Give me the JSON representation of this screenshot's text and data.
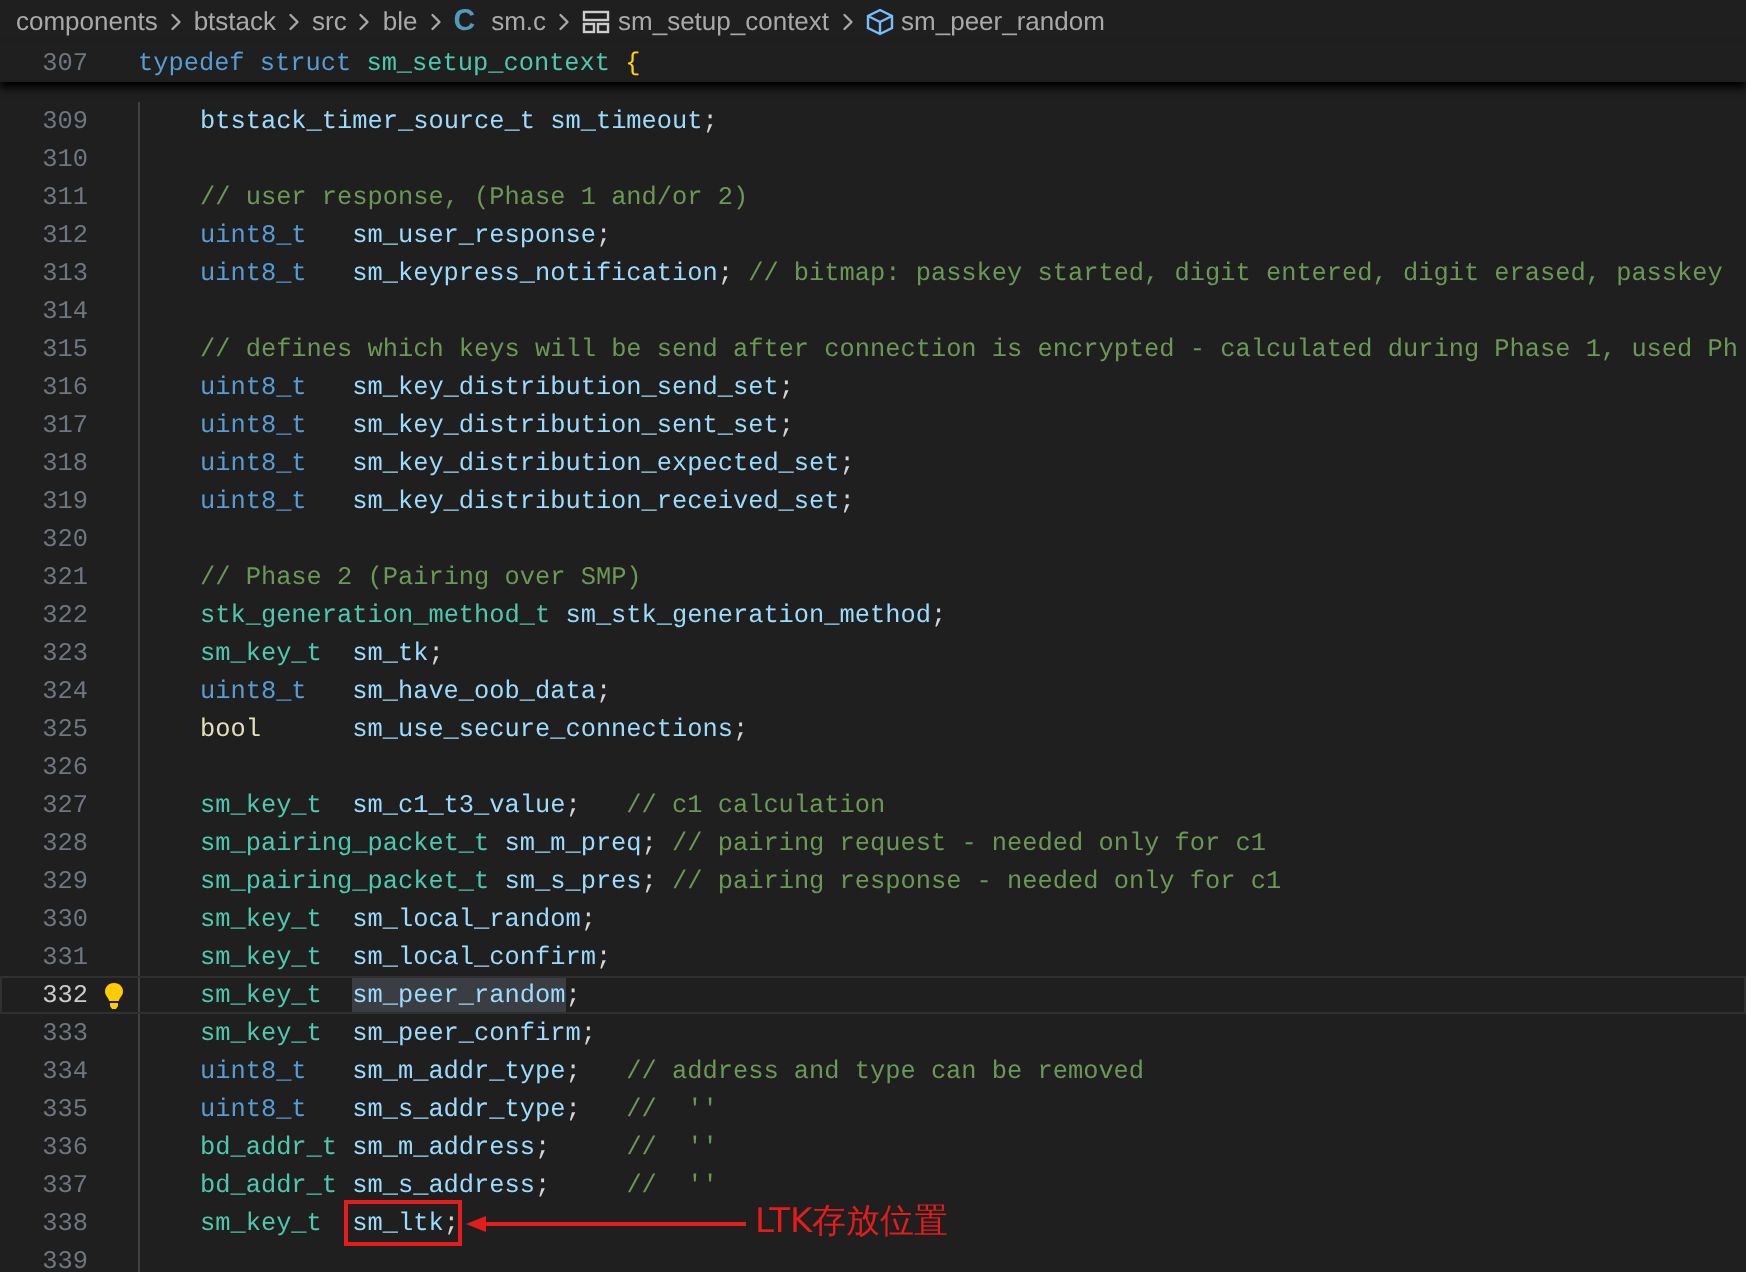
{
  "breadcrumbs": [
    {
      "kind": "folder",
      "label": "components"
    },
    {
      "kind": "folder",
      "label": "btstack"
    },
    {
      "kind": "folder",
      "label": "src"
    },
    {
      "kind": "folder",
      "label": "ble"
    },
    {
      "kind": "file",
      "icon_text": "C",
      "label": "sm.c"
    },
    {
      "kind": "struct",
      "label": "sm_setup_context"
    },
    {
      "kind": "field",
      "label": "sm_peer_random"
    }
  ],
  "sticky_line": {
    "number": "307",
    "keywords": [
      "typedef",
      "struct"
    ],
    "name": "sm_setup_context",
    "brace": "{"
  },
  "lines": [
    {
      "number": "309",
      "current": false,
      "lightbulb": false,
      "type": {
        "text": "btstack_timer_source_t",
        "kind": "plain"
      },
      "name": "sm_timeout",
      "punct": ";"
    },
    {
      "number": "310",
      "current": false,
      "lightbulb": false
    },
    {
      "number": "311",
      "current": false,
      "lightbulb": false,
      "comment": "// user response, (Phase 1 and/or 2)"
    },
    {
      "number": "312",
      "current": false,
      "lightbulb": false,
      "type": {
        "text": "uint8_t",
        "kind": "builtin"
      },
      "name": "sm_user_response",
      "punct": ";"
    },
    {
      "number": "313",
      "current": false,
      "lightbulb": false,
      "type": {
        "text": "uint8_t",
        "kind": "builtin"
      },
      "name": "sm_keypress_notification",
      "punct": ";",
      "comment": "// bitmap: passkey started, digit entered, digit erased, passkey"
    },
    {
      "number": "314",
      "current": false,
      "lightbulb": false
    },
    {
      "number": "315",
      "current": false,
      "lightbulb": false,
      "comment": "// defines which keys will be send after connection is encrypted - calculated during Phase 1, used Ph"
    },
    {
      "number": "316",
      "current": false,
      "lightbulb": false,
      "type": {
        "text": "uint8_t",
        "kind": "builtin"
      },
      "name": "sm_key_distribution_send_set",
      "punct": ";"
    },
    {
      "number": "317",
      "current": false,
      "lightbulb": false,
      "type": {
        "text": "uint8_t",
        "kind": "builtin"
      },
      "name": "sm_key_distribution_sent_set",
      "punct": ";"
    },
    {
      "number": "318",
      "current": false,
      "lightbulb": false,
      "type": {
        "text": "uint8_t",
        "kind": "builtin"
      },
      "name": "sm_key_distribution_expected_set",
      "punct": ";"
    },
    {
      "number": "319",
      "current": false,
      "lightbulb": false,
      "type": {
        "text": "uint8_t",
        "kind": "builtin"
      },
      "name": "sm_key_distribution_received_set",
      "punct": ";"
    },
    {
      "number": "320",
      "current": false,
      "lightbulb": false
    },
    {
      "number": "321",
      "current": false,
      "lightbulb": false,
      "comment": "// Phase 2 (Pairing over SMP)"
    },
    {
      "number": "322",
      "current": false,
      "lightbulb": false,
      "type": {
        "text": "stk_generation_method_t",
        "kind": "user"
      },
      "name": "sm_stk_generation_method",
      "punct": ";"
    },
    {
      "number": "323",
      "current": false,
      "lightbulb": false,
      "type": {
        "text": "sm_key_t",
        "kind": "user"
      },
      "name": "sm_tk",
      "punct": ";"
    },
    {
      "number": "324",
      "current": false,
      "lightbulb": false,
      "type": {
        "text": "uint8_t",
        "kind": "builtin"
      },
      "name": "sm_have_oob_data",
      "punct": ";"
    },
    {
      "number": "325",
      "current": false,
      "lightbulb": false,
      "type": {
        "text": "bool",
        "kind": "bool"
      },
      "name": "sm_use_secure_connections",
      "punct": ";"
    },
    {
      "number": "326",
      "current": false,
      "lightbulb": false
    },
    {
      "number": "327",
      "current": false,
      "lightbulb": false,
      "type": {
        "text": "sm_key_t",
        "kind": "user"
      },
      "name": "sm_c1_t3_value",
      "punct": ";",
      "comment": "// c1 calculation"
    },
    {
      "number": "328",
      "current": false,
      "lightbulb": false,
      "type": {
        "text": "sm_pairing_packet_t",
        "kind": "user"
      },
      "name": "sm_m_preq",
      "punct": ";",
      "comment": "// pairing request - needed only for c1"
    },
    {
      "number": "329",
      "current": false,
      "lightbulb": false,
      "type": {
        "text": "sm_pairing_packet_t",
        "kind": "user"
      },
      "name": "sm_s_pres",
      "punct": ";",
      "comment": "// pairing response - needed only for c1"
    },
    {
      "number": "330",
      "current": false,
      "lightbulb": false,
      "type": {
        "text": "sm_key_t",
        "kind": "user"
      },
      "name": "sm_local_random",
      "punct": ";"
    },
    {
      "number": "331",
      "current": false,
      "lightbulb": false,
      "type": {
        "text": "sm_key_t",
        "kind": "user"
      },
      "name": "sm_local_confirm",
      "punct": ";"
    },
    {
      "number": "332",
      "current": true,
      "lightbulb": true,
      "type": {
        "text": "sm_key_t",
        "kind": "user"
      },
      "name": "sm_peer_random",
      "name_highlighted": true,
      "punct": ";"
    },
    {
      "number": "333",
      "current": false,
      "lightbulb": false,
      "type": {
        "text": "sm_key_t",
        "kind": "user"
      },
      "name": "sm_peer_confirm",
      "punct": ";"
    },
    {
      "number": "334",
      "current": false,
      "lightbulb": false,
      "type": {
        "text": "uint8_t",
        "kind": "builtin"
      },
      "name": "sm_m_addr_type",
      "punct": ";",
      "comment": "// address and type can be removed"
    },
    {
      "number": "335",
      "current": false,
      "lightbulb": false,
      "type": {
        "text": "uint8_t",
        "kind": "builtin"
      },
      "name": "sm_s_addr_type",
      "punct": ";",
      "comment": "//  ''"
    },
    {
      "number": "336",
      "current": false,
      "lightbulb": false,
      "type": {
        "text": "bd_addr_t",
        "kind": "user"
      },
      "name": "sm_m_address",
      "punct": ";",
      "comment": "//  ''"
    },
    {
      "number": "337",
      "current": false,
      "lightbulb": false,
      "type": {
        "text": "bd_addr_t",
        "kind": "user"
      },
      "name": "sm_s_address",
      "punct": ";",
      "comment": "//  ''"
    },
    {
      "number": "338",
      "current": false,
      "lightbulb": false,
      "type": {
        "text": "sm_key_t",
        "kind": "user"
      },
      "name": "sm_ltk",
      "punct": ";",
      "annotation": "LTK存放位置"
    },
    {
      "number": "339",
      "current": false,
      "lightbulb": false
    }
  ]
}
